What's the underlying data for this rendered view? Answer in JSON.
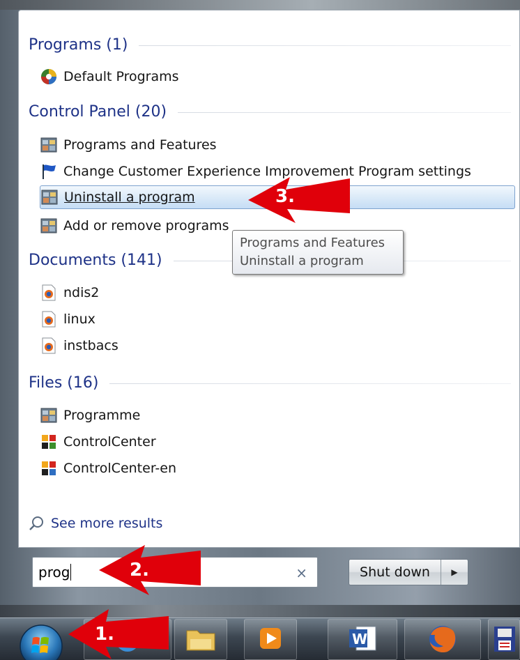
{
  "start_menu": {
    "sections": [
      {
        "title": "Programs (1)",
        "items": [
          {
            "label": "Default Programs",
            "icon": "default-programs-icon"
          }
        ]
      },
      {
        "title": "Control Panel (20)",
        "items": [
          {
            "label": "Programs and Features",
            "icon": "control-panel-icon"
          },
          {
            "label": "Change Customer Experience Improvement Program settings",
            "icon": "blue-flag-icon"
          },
          {
            "label": "Uninstall a program",
            "icon": "control-panel-icon",
            "selected": true
          },
          {
            "label": "Add or remove programs",
            "icon": "control-panel-icon"
          }
        ]
      },
      {
        "title": "Documents (141)",
        "items": [
          {
            "label": "ndis2",
            "icon": "firefox-document-icon"
          },
          {
            "label": "linux",
            "icon": "firefox-document-icon"
          },
          {
            "label": "instbacs",
            "icon": "firefox-document-icon"
          }
        ]
      },
      {
        "title": "Files (16)",
        "items": [
          {
            "label": "Programme",
            "icon": "control-panel-icon"
          },
          {
            "label": "ControlCenter",
            "icon": "control-center-icon"
          },
          {
            "label": "ControlCenter-en",
            "icon": "control-center-icon"
          }
        ]
      }
    ],
    "see_more": "See more results",
    "search": {
      "value": "prog",
      "clear_glyph": "×"
    },
    "shutdown": {
      "label": "Shut down",
      "arrow_glyph": "▶"
    }
  },
  "tooltip": {
    "line1": "Programs and Features",
    "line2": "Uninstall a program"
  },
  "annotations": {
    "step1": "1.",
    "step2": "2.",
    "step3": "3."
  },
  "taskbar": {
    "buttons": [
      "ie-icon",
      "file-explorer-icon",
      "media-player-icon",
      "word-icon",
      "firefox-icon",
      "save-floppy-icon"
    ]
  },
  "colors": {
    "section_title": "#1e3287",
    "selection_border": "#7da2ce",
    "arrow_red": "#e0000a"
  }
}
